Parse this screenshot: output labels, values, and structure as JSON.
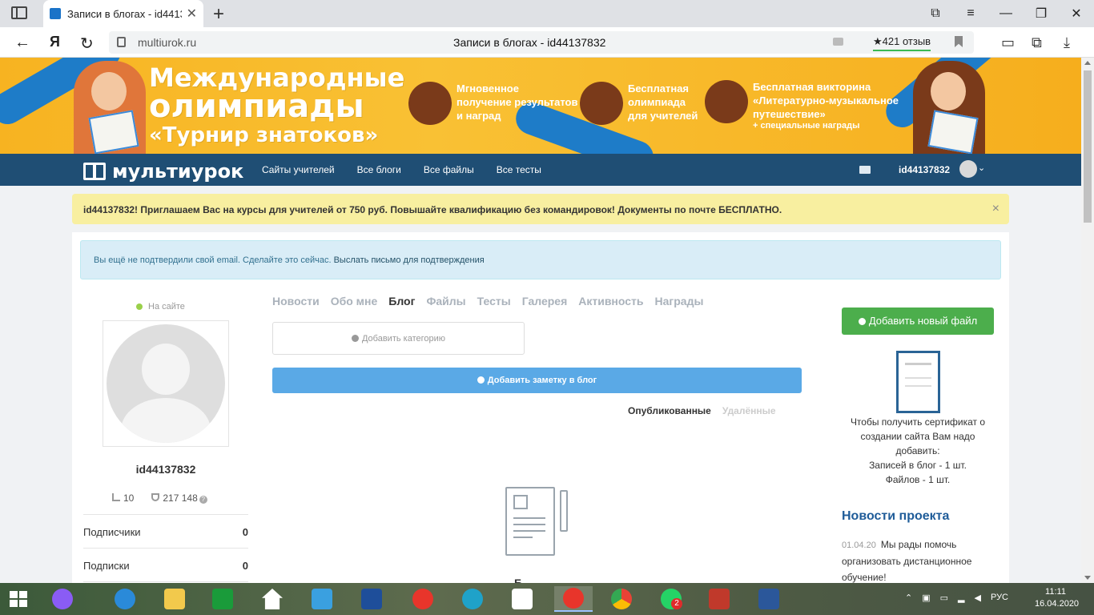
{
  "browser": {
    "tab_title": "Записи в блогах - id4413",
    "url_host": "multiurok.ru",
    "page_title": "Записи в блогах - id44137832",
    "reviews": "★421 отзыв"
  },
  "banner": {
    "line1": "Международные",
    "line2": "олимпиады",
    "line3": "«Турнир знатоков»",
    "features": [
      {
        "text": "Мгновенное\nполучение результатов\nи наград",
        "icon": "runner-icon"
      },
      {
        "text": "Бесплатная\nолимпиада\nдля учителей",
        "icon": "teacher-icon"
      },
      {
        "text": "Бесплатная викторина\n«Литературно-музыкальное\nпутешествие»",
        "sub": "+ специальные награды",
        "icon": "pegasus-icon"
      }
    ]
  },
  "site_nav": {
    "logo": "мультиурок",
    "links": [
      "Сайты учителей",
      "Все блоги",
      "Все файлы",
      "Все тесты"
    ],
    "username": "id44137832"
  },
  "promo": {
    "message": "id44137832! Приглашаем Вас на курсы для учителей от 750 руб. Повышайте квалификацию без командировок! Документы по почте БЕСПЛАТНО.",
    "close": "×"
  },
  "alert": {
    "text": "Вы ещё не подтвердили свой email. Сделайте это сейчас.",
    "link": "Выслать письмо для подтверждения"
  },
  "profile": {
    "status": "На сайте",
    "name": "id44137832",
    "rating": "10",
    "points": "217 148",
    "rows": [
      {
        "label": "Подписчики",
        "value": "0"
      },
      {
        "label": "Подписки",
        "value": "0"
      }
    ]
  },
  "profile_tabs": [
    "Новости",
    "Обо мне",
    "Блог",
    "Файлы",
    "Тесты",
    "Галерея",
    "Активность",
    "Награды"
  ],
  "active_tab": "Блог",
  "blog": {
    "add_category": "Добавить категорию",
    "add_note": "Добавить заметку в блог",
    "published": "Опубликованные",
    "deleted": "Удалённые",
    "empty_text": "Б"
  },
  "sidebar": {
    "add_file": "Добавить новый файл",
    "cert_lines": [
      "Чтобы получить сертификат о",
      "создании сайта Вам надо",
      "добавить:",
      "Записей в блог - 1 шт.",
      "Файлов - 1 шт."
    ],
    "news_header": "Новости проекта",
    "news_date": "01.04.20",
    "news_text": "Мы рады помочь организовать дистанционное обучение!"
  },
  "taskbar": {
    "lang": "РУС",
    "time": "11:11",
    "date": "16.04.2020",
    "whatsapp_badge": "2"
  },
  "colors": {
    "nav_bg": "#1f4e74",
    "banner": "#f9c134",
    "primary_button": "#5aa9e6",
    "success_button": "#4cae4c",
    "promo_bg": "#f8efa0"
  }
}
